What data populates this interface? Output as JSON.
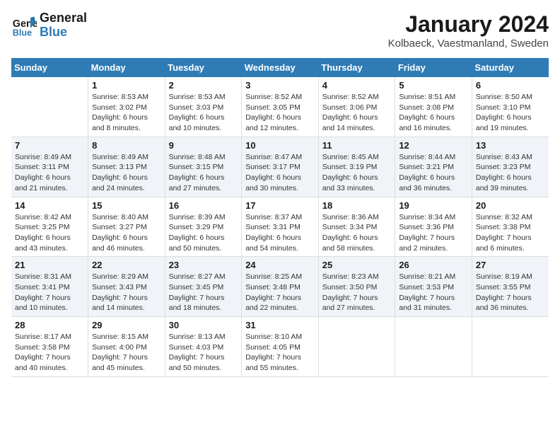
{
  "logo": {
    "line1": "General",
    "line2": "Blue"
  },
  "title": "January 2024",
  "subtitle": "Kolbaeck, Vaestmanland, Sweden",
  "days_of_week": [
    "Sunday",
    "Monday",
    "Tuesday",
    "Wednesday",
    "Thursday",
    "Friday",
    "Saturday"
  ],
  "weeks": [
    [
      {
        "day": "",
        "info": ""
      },
      {
        "day": "1",
        "info": "Sunrise: 8:53 AM\nSunset: 3:02 PM\nDaylight: 6 hours\nand 8 minutes."
      },
      {
        "day": "2",
        "info": "Sunrise: 8:53 AM\nSunset: 3:03 PM\nDaylight: 6 hours\nand 10 minutes."
      },
      {
        "day": "3",
        "info": "Sunrise: 8:52 AM\nSunset: 3:05 PM\nDaylight: 6 hours\nand 12 minutes."
      },
      {
        "day": "4",
        "info": "Sunrise: 8:52 AM\nSunset: 3:06 PM\nDaylight: 6 hours\nand 14 minutes."
      },
      {
        "day": "5",
        "info": "Sunrise: 8:51 AM\nSunset: 3:08 PM\nDaylight: 6 hours\nand 16 minutes."
      },
      {
        "day": "6",
        "info": "Sunrise: 8:50 AM\nSunset: 3:10 PM\nDaylight: 6 hours\nand 19 minutes."
      }
    ],
    [
      {
        "day": "7",
        "info": "Sunrise: 8:49 AM\nSunset: 3:11 PM\nDaylight: 6 hours\nand 21 minutes."
      },
      {
        "day": "8",
        "info": "Sunrise: 8:49 AM\nSunset: 3:13 PM\nDaylight: 6 hours\nand 24 minutes."
      },
      {
        "day": "9",
        "info": "Sunrise: 8:48 AM\nSunset: 3:15 PM\nDaylight: 6 hours\nand 27 minutes."
      },
      {
        "day": "10",
        "info": "Sunrise: 8:47 AM\nSunset: 3:17 PM\nDaylight: 6 hours\nand 30 minutes."
      },
      {
        "day": "11",
        "info": "Sunrise: 8:45 AM\nSunset: 3:19 PM\nDaylight: 6 hours\nand 33 minutes."
      },
      {
        "day": "12",
        "info": "Sunrise: 8:44 AM\nSunset: 3:21 PM\nDaylight: 6 hours\nand 36 minutes."
      },
      {
        "day": "13",
        "info": "Sunrise: 8:43 AM\nSunset: 3:23 PM\nDaylight: 6 hours\nand 39 minutes."
      }
    ],
    [
      {
        "day": "14",
        "info": "Sunrise: 8:42 AM\nSunset: 3:25 PM\nDaylight: 6 hours\nand 43 minutes."
      },
      {
        "day": "15",
        "info": "Sunrise: 8:40 AM\nSunset: 3:27 PM\nDaylight: 6 hours\nand 46 minutes."
      },
      {
        "day": "16",
        "info": "Sunrise: 8:39 AM\nSunset: 3:29 PM\nDaylight: 6 hours\nand 50 minutes."
      },
      {
        "day": "17",
        "info": "Sunrise: 8:37 AM\nSunset: 3:31 PM\nDaylight: 6 hours\nand 54 minutes."
      },
      {
        "day": "18",
        "info": "Sunrise: 8:36 AM\nSunset: 3:34 PM\nDaylight: 6 hours\nand 58 minutes."
      },
      {
        "day": "19",
        "info": "Sunrise: 8:34 AM\nSunset: 3:36 PM\nDaylight: 7 hours\nand 2 minutes."
      },
      {
        "day": "20",
        "info": "Sunrise: 8:32 AM\nSunset: 3:38 PM\nDaylight: 7 hours\nand 6 minutes."
      }
    ],
    [
      {
        "day": "21",
        "info": "Sunrise: 8:31 AM\nSunset: 3:41 PM\nDaylight: 7 hours\nand 10 minutes."
      },
      {
        "day": "22",
        "info": "Sunrise: 8:29 AM\nSunset: 3:43 PM\nDaylight: 7 hours\nand 14 minutes."
      },
      {
        "day": "23",
        "info": "Sunrise: 8:27 AM\nSunset: 3:45 PM\nDaylight: 7 hours\nand 18 minutes."
      },
      {
        "day": "24",
        "info": "Sunrise: 8:25 AM\nSunset: 3:48 PM\nDaylight: 7 hours\nand 22 minutes."
      },
      {
        "day": "25",
        "info": "Sunrise: 8:23 AM\nSunset: 3:50 PM\nDaylight: 7 hours\nand 27 minutes."
      },
      {
        "day": "26",
        "info": "Sunrise: 8:21 AM\nSunset: 3:53 PM\nDaylight: 7 hours\nand 31 minutes."
      },
      {
        "day": "27",
        "info": "Sunrise: 8:19 AM\nSunset: 3:55 PM\nDaylight: 7 hours\nand 36 minutes."
      }
    ],
    [
      {
        "day": "28",
        "info": "Sunrise: 8:17 AM\nSunset: 3:58 PM\nDaylight: 7 hours\nand 40 minutes."
      },
      {
        "day": "29",
        "info": "Sunrise: 8:15 AM\nSunset: 4:00 PM\nDaylight: 7 hours\nand 45 minutes."
      },
      {
        "day": "30",
        "info": "Sunrise: 8:13 AM\nSunset: 4:03 PM\nDaylight: 7 hours\nand 50 minutes."
      },
      {
        "day": "31",
        "info": "Sunrise: 8:10 AM\nSunset: 4:05 PM\nDaylight: 7 hours\nand 55 minutes."
      },
      {
        "day": "",
        "info": ""
      },
      {
        "day": "",
        "info": ""
      },
      {
        "day": "",
        "info": ""
      }
    ]
  ]
}
